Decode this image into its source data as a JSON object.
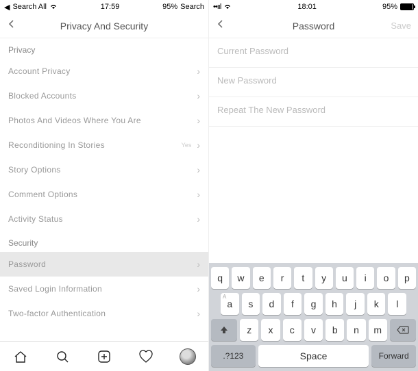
{
  "left": {
    "status": {
      "search": "Search All",
      "time": "17:59",
      "battery": "95%",
      "right_label": "Search"
    },
    "header": {
      "title": "Privacy And Security"
    },
    "sections": {
      "privacy_header": "Privacy",
      "security_header": "Security"
    },
    "items": {
      "account_privacy": "Account Privacy",
      "blocked": "Blocked Accounts",
      "photos": "Photos And Videos Where You Are",
      "recond": "Reconditioning In Stories",
      "recond_note": "Yes",
      "story_options": "Story Options",
      "comment_options": "Comment Options",
      "activity": "Activity Status",
      "password": "Password",
      "saved_login": "Saved Login Information",
      "two_factor": "Two-factor Authentication"
    }
  },
  "right": {
    "status": {
      "time": "18:01",
      "battery": "95%"
    },
    "header": {
      "title": "Password",
      "save": "Save"
    },
    "fields": {
      "current": "Current Password",
      "new": "New Password",
      "repeat": "Repeat The New Password"
    }
  },
  "keyboard": {
    "row1": [
      "q",
      "w",
      "e",
      "r",
      "t",
      "y",
      "u",
      "i",
      "o",
      "p"
    ],
    "row2": [
      "a",
      "s",
      "d",
      "f",
      "g",
      "h",
      "j",
      "k",
      "l"
    ],
    "row3": [
      "z",
      "x",
      "c",
      "v",
      "b",
      "n",
      "m"
    ],
    "num": ".?123",
    "space": "Space",
    "forward": "Forward"
  }
}
